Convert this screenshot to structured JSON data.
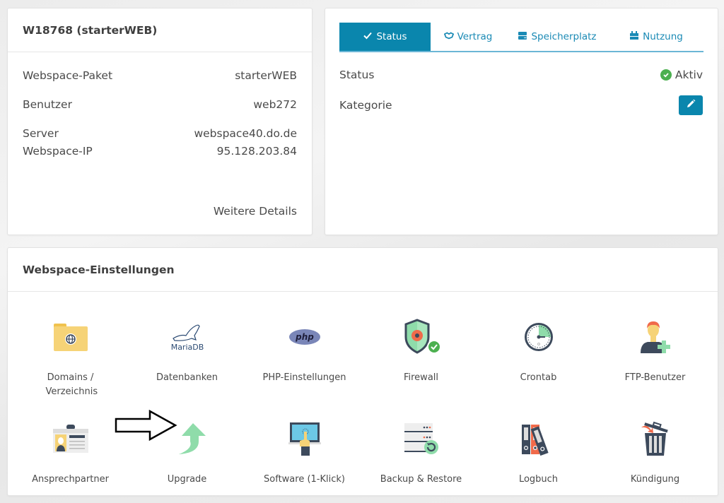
{
  "info_card": {
    "title": "W18768 (starterWEB)",
    "rows": [
      {
        "label": "Webspace-Paket",
        "value": "starterWEB"
      },
      {
        "label": "Benutzer",
        "value": "web272"
      },
      {
        "label": "Server",
        "value": "webspace40.do.de"
      },
      {
        "label": "Webspace-IP",
        "value": "95.128.203.84"
      }
    ],
    "more_link": "Weitere Details"
  },
  "status_card": {
    "tabs": [
      {
        "label": "Status",
        "icon": "check-icon",
        "active": true
      },
      {
        "label": "Vertrag",
        "icon": "handshake-icon",
        "active": false
      },
      {
        "label": "Speicherplatz",
        "icon": "hdd-icon",
        "active": false
      },
      {
        "label": "Nutzung",
        "icon": "stack-icon",
        "active": false
      }
    ],
    "status_label": "Status",
    "status_value": "Aktiv",
    "category_label": "Kategorie",
    "edit_icon": "pencil-icon"
  },
  "settings": {
    "title": "Webspace-Einstellungen",
    "items": [
      {
        "label": "Domains / Verzeichnis",
        "icon": "folder-globe-icon"
      },
      {
        "label": "Datenbanken",
        "icon": "mariadb-icon"
      },
      {
        "label": "PHP-Einstellungen",
        "icon": "php-icon"
      },
      {
        "label": "Firewall",
        "icon": "shield-icon"
      },
      {
        "label": "Crontab",
        "icon": "clock-icon"
      },
      {
        "label": "FTP-Benutzer",
        "icon": "user-add-icon"
      },
      {
        "label": "Ansprechpartner",
        "icon": "id-card-icon"
      },
      {
        "label": "Upgrade",
        "icon": "upgrade-arrow-icon"
      },
      {
        "label": "Software (1-Klick)",
        "icon": "touch-screen-icon"
      },
      {
        "label": "Backup & Restore",
        "icon": "server-restore-icon"
      },
      {
        "label": "Logbuch",
        "icon": "binders-icon"
      },
      {
        "label": "Kündigung",
        "icon": "trash-icon"
      }
    ]
  },
  "colors": {
    "accent": "#0a86ad",
    "success": "#4cb050",
    "orange": "#f06a4a",
    "navy": "#3d4a5c",
    "mint": "#8fdcaa"
  }
}
